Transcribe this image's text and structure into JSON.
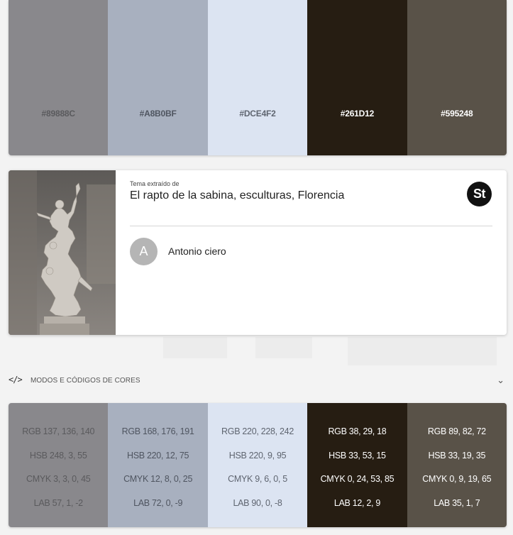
{
  "palette": [
    {
      "hex": "#89888C",
      "color": "#89888C",
      "text_color": "#5a5a5d",
      "rgb": "RGB 137, 136, 140",
      "hsb": "HSB 248, 3, 55",
      "cmyk": "CMYK 3, 3, 0, 45",
      "lab": "LAB 57, 1, -2"
    },
    {
      "hex": "#A8B0BF",
      "color": "#A8B0BF",
      "text_color": "#4f5560",
      "rgb": "RGB 168, 176, 191",
      "hsb": "HSB 220, 12, 75",
      "cmyk": "CMYK 12, 8, 0, 25",
      "lab": "LAB 72, 0, -9"
    },
    {
      "hex": "#DCE4F2",
      "color": "#DCE4F2",
      "text_color": "#5f6570",
      "rgb": "RGB 220, 228, 242",
      "hsb": "HSB 220, 9, 95",
      "cmyk": "CMYK 9, 6, 0, 5",
      "lab": "LAB 90, 0, -8"
    },
    {
      "hex": "#261D12",
      "color": "#261D12",
      "text_color": "#ffffff",
      "rgb": "RGB 38, 29, 18",
      "hsb": "HSB 33, 53, 15",
      "cmyk": "CMYK 0, 24, 53, 85",
      "lab": "LAB 12, 2, 9"
    },
    {
      "hex": "#595248",
      "color": "#595248",
      "text_color": "#ffffff",
      "rgb": "RGB 89, 82, 72",
      "hsb": "HSB 33, 19, 35",
      "cmyk": "CMYK 0, 9, 19, 65",
      "lab": "LAB 35, 1, 7"
    }
  ],
  "source_card": {
    "extracted_label": "Tema extraído de",
    "title": "El rapto de la sabina, esculturas, Florencia",
    "badge": "St",
    "author_initial": "A",
    "author_name": "Antonio ciero"
  },
  "codes_section": {
    "icon": "</>",
    "title": "MODOS E CÓDIGOS DE CORES",
    "chevron": "⌄"
  }
}
